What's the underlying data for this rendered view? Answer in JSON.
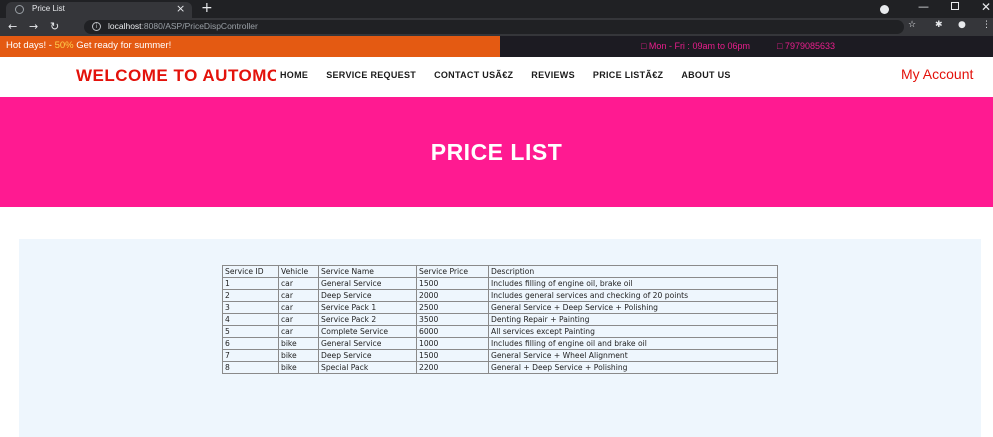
{
  "browser": {
    "tab_title": "Price List",
    "url_host": "localhost",
    "url_rest": ":8080/ASP/PriceDispController"
  },
  "topbar": {
    "promo_prefix": "Hot days! - ",
    "promo_accent": "50%",
    "promo_suffix": " Get ready for summer!",
    "hours": "□  Mon - Fri : 09am to 06pm",
    "phone": "□  7979085633",
    "colors": {
      "left_bg": "#e45a12",
      "right_bg": "#1c1b22",
      "contact": "#e91e8c"
    }
  },
  "header": {
    "brand": "WELCOME TO AUTOMOBILE",
    "menu": [
      "HOME",
      "SERVICE REQUEST",
      "CONTACT USÃ€Z",
      "REVIEWS",
      "PRICE LISTÃ€Z",
      "ABOUT US"
    ],
    "account": "My Account",
    "colors": {
      "brand": "#e3120b"
    }
  },
  "hero": {
    "title": "PRICE LIST",
    "color": "#ff1a91"
  },
  "price_table": {
    "columns": [
      "Service ID",
      "Vehicle",
      "Service Name",
      "Service Price",
      "Description"
    ],
    "rows": [
      [
        "1",
        "car",
        "General Service",
        "1500",
        "Includes filling of engine oil, brake oil"
      ],
      [
        "2",
        "car",
        "Deep Service",
        "2000",
        "Includes general services and checking of 20 points"
      ],
      [
        "3",
        "car",
        "Service Pack 1",
        "2500",
        "General Service + Deep Service + Polishing"
      ],
      [
        "4",
        "car",
        "Service Pack 2",
        "3500",
        "Denting Repair + Painting"
      ],
      [
        "5",
        "car",
        "Complete Service",
        "6000",
        "All services except Painting"
      ],
      [
        "6",
        "bike",
        "General Service",
        "1000",
        "Includes filling of engine oil and brake oil"
      ],
      [
        "7",
        "bike",
        "Deep Service",
        "1500",
        "General Service + Wheel Alignment"
      ],
      [
        "8",
        "bike",
        "Special Pack",
        "2200",
        "General + Deep Service + Polishing"
      ]
    ]
  }
}
